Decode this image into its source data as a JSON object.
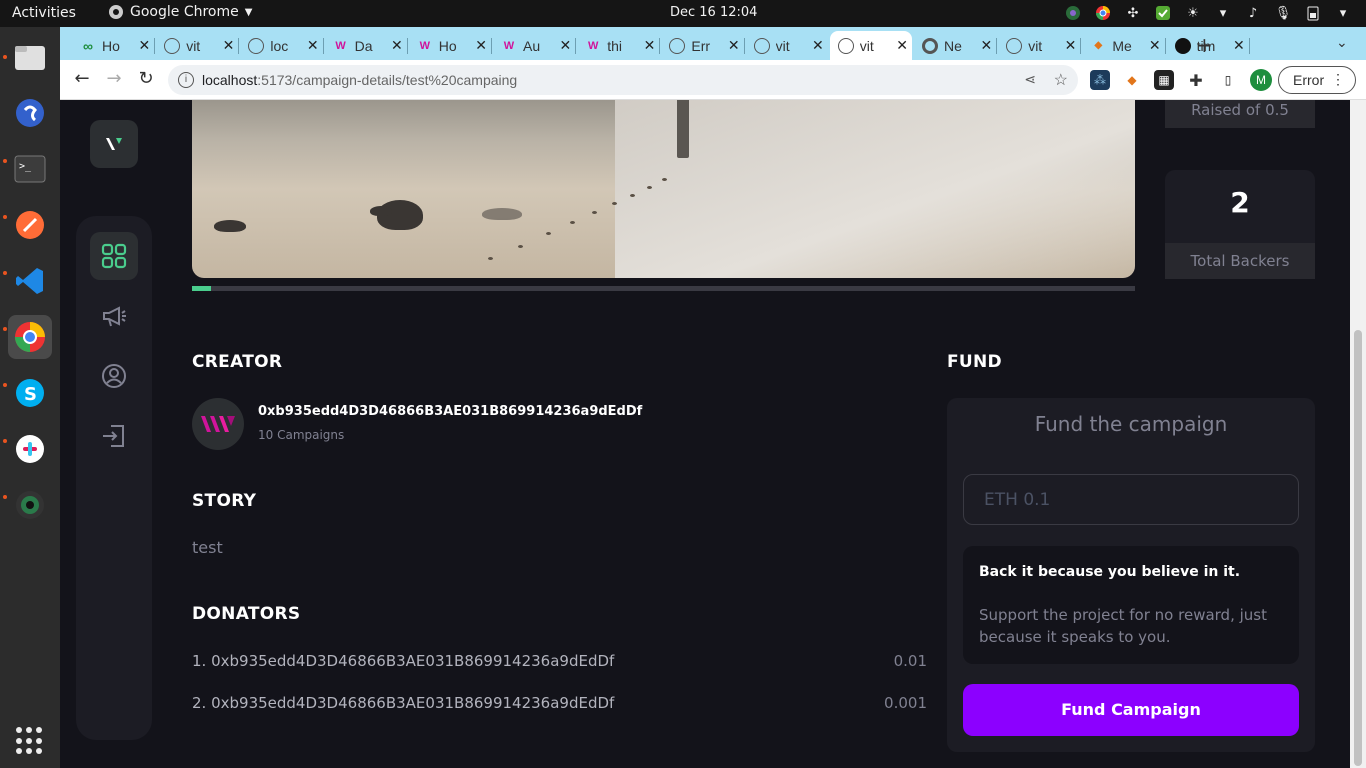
{
  "os": {
    "activities": "Activities",
    "app_name": "Google Chrome",
    "clock": "Dec 16  12:04"
  },
  "browser": {
    "tabs": [
      {
        "label": "Ho",
        "fav": "infinity-icon",
        "color": "#1e8e3e"
      },
      {
        "label": "vit",
        "fav": "globe-icon",
        "color": "#555"
      },
      {
        "label": "loc",
        "fav": "globe-icon",
        "color": "#555"
      },
      {
        "label": "Da",
        "fav": "w-logo-icon",
        "color": "#d0149b"
      },
      {
        "label": "Ho",
        "fav": "w-logo-icon",
        "color": "#d0149b"
      },
      {
        "label": "Au",
        "fav": "w-logo-icon",
        "color": "#d0149b"
      },
      {
        "label": "thi",
        "fav": "w-logo-icon",
        "color": "#d0149b"
      },
      {
        "label": "Err",
        "fav": "globe-icon",
        "color": "#555"
      },
      {
        "label": "vit",
        "fav": "globe-icon",
        "color": "#555"
      },
      {
        "label": "vit",
        "fav": "globe-icon",
        "color": "#555"
      },
      {
        "label": "Ne",
        "fav": "chrome-icon",
        "color": "#555"
      },
      {
        "label": "vit",
        "fav": "globe-icon",
        "color": "#555"
      },
      {
        "label": "Me",
        "fav": "fox-icon",
        "color": "#e2761b"
      },
      {
        "label": "tim",
        "fav": "github-icon",
        "color": "#111"
      }
    ],
    "url_host": "localhost",
    "url_path": ":5173/campaign-details/test%20campaing",
    "error_label": "Error",
    "profile_initial": "M"
  },
  "campaign": {
    "raised_of": "Raised of 0.5",
    "backers_count": "2",
    "backers_label": "Total Backers",
    "progress_fraction": 0.02,
    "creator_heading": "CREATOR",
    "creator_address": "0xb935edd4D3D46866B3AE031B869914236a9dEdDf",
    "creator_campaigns": "10 Campaigns",
    "story_heading": "STORY",
    "story_text": "test",
    "donators_heading": "DONATORS",
    "donators": [
      {
        "label": "1. 0xb935edd4D3D46866B3AE031B869914236a9dEdDf",
        "amount": "0.01"
      },
      {
        "label": "2. 0xb935edd4D3D46866B3AE031B869914236a9dEdDf",
        "amount": "0.001"
      }
    ]
  },
  "fund": {
    "heading": "FUND",
    "card_title": "Fund the campaign",
    "input_placeholder": "ETH 0.1",
    "info_title": "Back it because you believe in it.",
    "info_text": "Support the project for no reward, just because it speaks to you.",
    "button_label": "Fund Campaign"
  },
  "colors": {
    "accent_green": "#4acd8d",
    "accent_purple": "#8c00ff",
    "background": "#13131a",
    "card": "#1c1c24"
  }
}
